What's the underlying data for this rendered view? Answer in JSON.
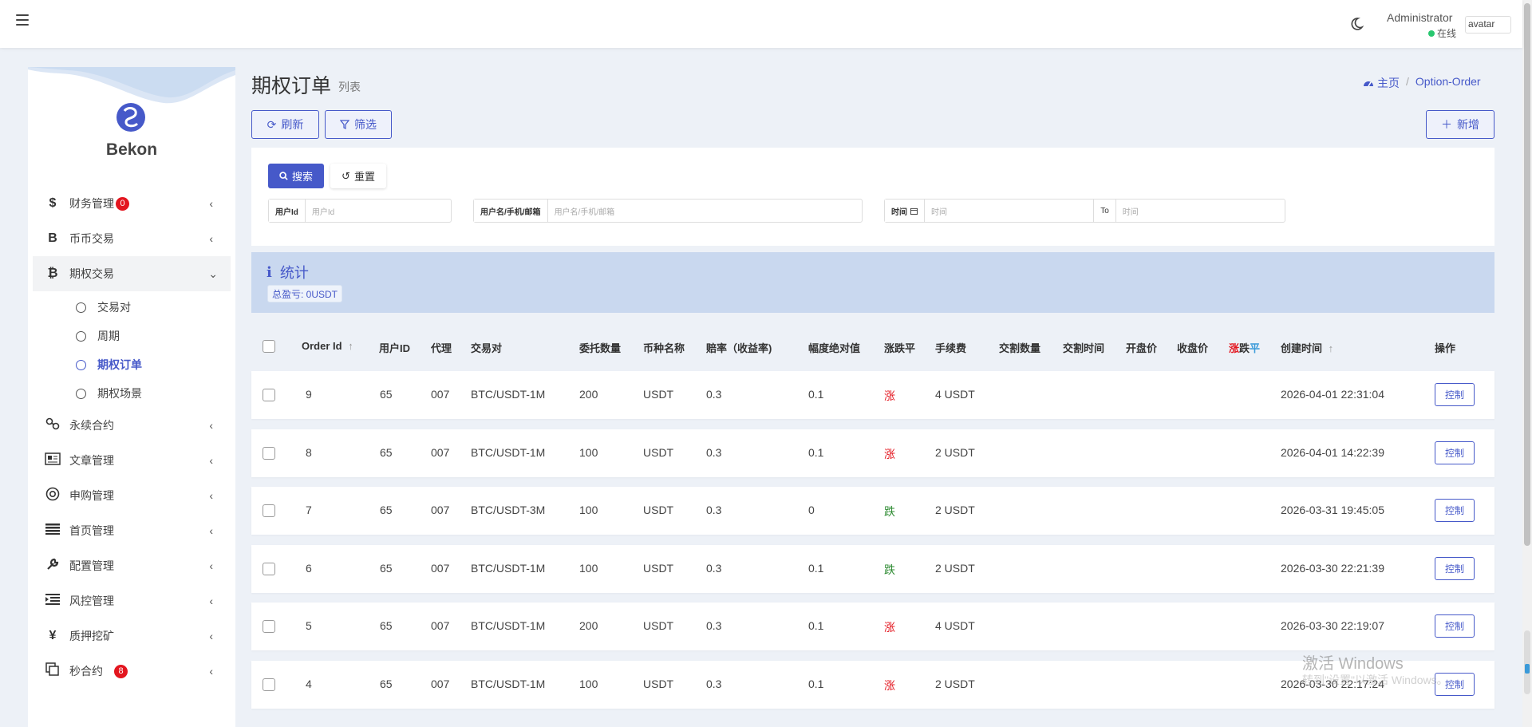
{
  "topbar": {
    "user_name": "Administrator",
    "user_status": "在线",
    "avatar_alt": "avatar"
  },
  "sidebar": {
    "brand": "Bekon",
    "items": [
      {
        "label": "财务管理",
        "icon": "$",
        "badge": "0"
      },
      {
        "label": "币币交易",
        "icon": "B"
      },
      {
        "label": "期权交易",
        "icon": "₿",
        "expanded": true,
        "children": [
          {
            "label": "交易对"
          },
          {
            "label": "周期"
          },
          {
            "label": "期权订单",
            "active": true
          },
          {
            "label": "期权场景"
          }
        ]
      },
      {
        "label": "永续合约",
        "icon": "link-icon"
      },
      {
        "label": "文章管理",
        "icon": "newspaper-icon"
      },
      {
        "label": "申购管理",
        "icon": "lifebuoy-icon"
      },
      {
        "label": "首页管理",
        "icon": "list-icon"
      },
      {
        "label": "配置管理",
        "icon": "wrench-icon"
      },
      {
        "label": "风控管理",
        "icon": "indent-icon"
      },
      {
        "label": "质押挖矿",
        "icon": "¥"
      },
      {
        "label": "秒合约",
        "icon": "copy-icon",
        "badge": "8"
      }
    ]
  },
  "header": {
    "title": "期权订单",
    "subtitle": "列表",
    "breadcrumb_home": "主页",
    "breadcrumb_current": "Option-Order"
  },
  "toolbar": {
    "refresh_label": "刷新",
    "filter_label": "筛选",
    "add_label": "新增"
  },
  "filter": {
    "search_label": "搜索",
    "reset_label": "重置",
    "user_id_label": "用户Id",
    "user_id_placeholder": "用户Id",
    "username_label": "用户名/手机/邮箱",
    "username_placeholder": "用户名/手机/邮箱",
    "time_label": "时间",
    "time_from_placeholder": "时间",
    "to_label": "To",
    "time_to_placeholder": "时间"
  },
  "stats": {
    "title": "统计",
    "total_pl": "总盈亏: 0USDT"
  },
  "table": {
    "headers": {
      "order_id": "Order Id",
      "user_id": "用户ID",
      "agent": "代理",
      "pair": "交易对",
      "amount": "委托数量",
      "currency": "币种名称",
      "rate": "赔率（收益率)",
      "range": "幅度绝对值",
      "direction_up": "涨",
      "direction_down": "跌",
      "direction_flat": "平",
      "fee": "手续费",
      "settle_qty": "交割数量",
      "settle_time": "交割时间",
      "open_price": "开盘价",
      "close_price": "收盘价",
      "result_up": "涨",
      "result_down": "跌",
      "result_flat": "平",
      "created_at": "创建时间",
      "actions": "操作"
    },
    "control_label": "控制",
    "rows": [
      {
        "order_id": "9",
        "user_id": "65",
        "agent": "007",
        "pair": "BTC/USDT-1M",
        "amount": "200",
        "currency": "USDT",
        "rate": "0.3",
        "range": "0.1",
        "direction": "涨",
        "dir_class": "up",
        "fee": "4 USDT",
        "created_at": "2026-04-01 22:31:04"
      },
      {
        "order_id": "8",
        "user_id": "65",
        "agent": "007",
        "pair": "BTC/USDT-1M",
        "amount": "100",
        "currency": "USDT",
        "rate": "0.3",
        "range": "0.1",
        "direction": "涨",
        "dir_class": "up",
        "fee": "2 USDT",
        "created_at": "2026-04-01 14:22:39"
      },
      {
        "order_id": "7",
        "user_id": "65",
        "agent": "007",
        "pair": "BTC/USDT-3M",
        "amount": "100",
        "currency": "USDT",
        "rate": "0.3",
        "range": "0",
        "direction": "跌",
        "dir_class": "down",
        "fee": "2 USDT",
        "created_at": "2026-03-31 19:45:05"
      },
      {
        "order_id": "6",
        "user_id": "65",
        "agent": "007",
        "pair": "BTC/USDT-1M",
        "amount": "100",
        "currency": "USDT",
        "rate": "0.3",
        "range": "0.1",
        "direction": "跌",
        "dir_class": "down",
        "fee": "2 USDT",
        "created_at": "2026-03-30 22:21:39"
      },
      {
        "order_id": "5",
        "user_id": "65",
        "agent": "007",
        "pair": "BTC/USDT-1M",
        "amount": "200",
        "currency": "USDT",
        "rate": "0.3",
        "range": "0.1",
        "direction": "涨",
        "dir_class": "up",
        "fee": "4 USDT",
        "created_at": "2026-03-30 22:19:07"
      },
      {
        "order_id": "4",
        "user_id": "65",
        "agent": "007",
        "pair": "BTC/USDT-1M",
        "amount": "100",
        "currency": "USDT",
        "rate": "0.3",
        "range": "0.1",
        "direction": "涨",
        "dir_class": "up",
        "fee": "2 USDT",
        "created_at": "2026-03-30 22:17:24"
      }
    ]
  },
  "watermark": {
    "line1": "激活 Windows",
    "line2": "转到\"设置\"以激活 Windows。"
  },
  "colors": {
    "accent": "#4659c9",
    "up": "#e3161f",
    "down": "#2e8b32",
    "stats_bg": "#c9d8ef",
    "badge": "#e3161f"
  }
}
